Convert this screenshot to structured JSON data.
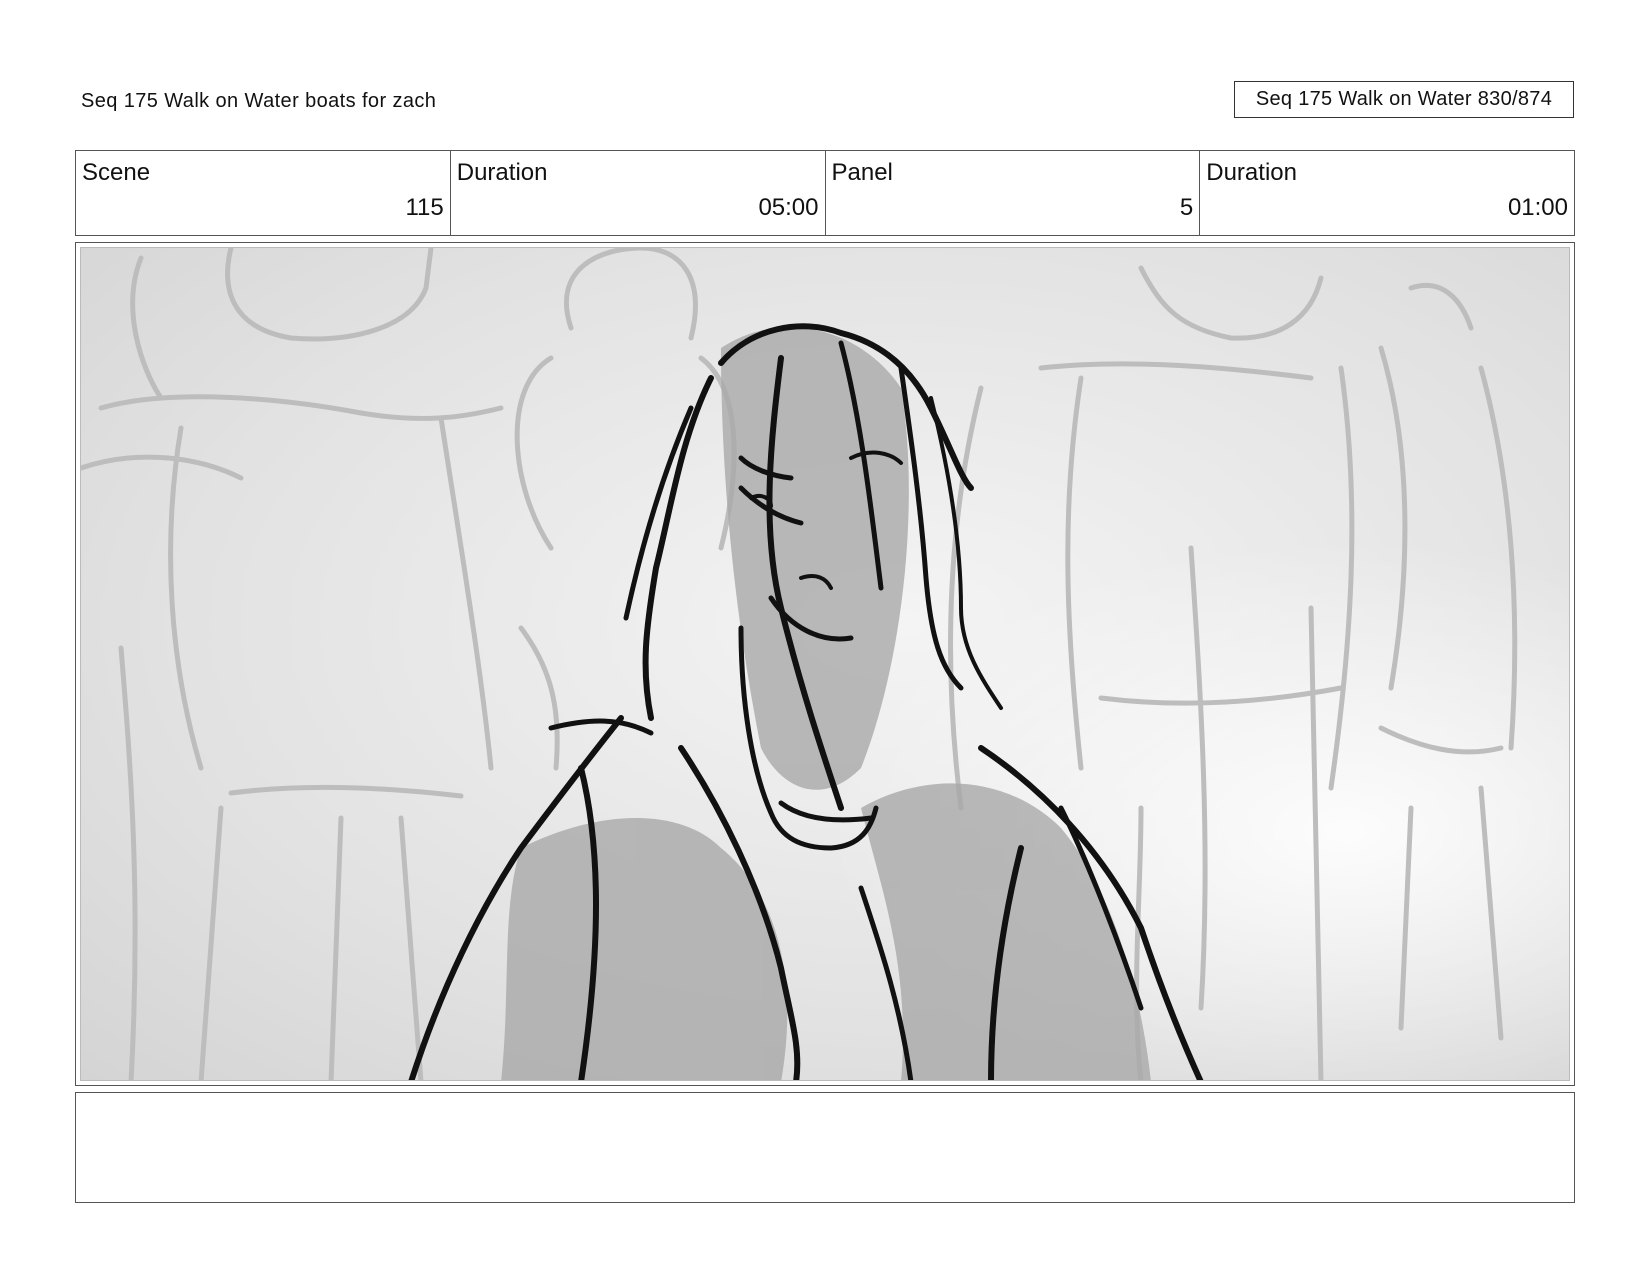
{
  "header": {
    "title": "Seq 175 Walk on Water  boats for zach",
    "page_label": "Seq 175 Walk on Water 830/874"
  },
  "info": [
    {
      "label": "Scene",
      "value": "115"
    },
    {
      "label": "Duration",
      "value": "05:00"
    },
    {
      "label": "Panel",
      "value": "5"
    },
    {
      "label": "Duration",
      "value": "01:00"
    }
  ],
  "panel": {
    "description": "Pencil storyboard sketch: long-haired man with a worried expression, crowd silhouettes in background"
  },
  "notes": {
    "text": ""
  }
}
